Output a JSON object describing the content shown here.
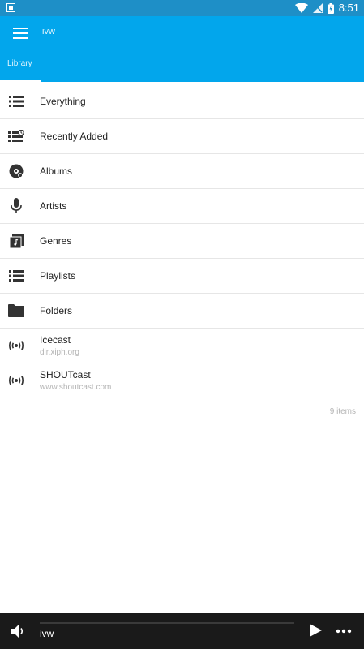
{
  "status_bar": {
    "time": "8:51"
  },
  "app_bar": {
    "title": "ivw"
  },
  "tabs": [
    {
      "label": "Library"
    }
  ],
  "library": {
    "items": [
      {
        "label": "Everything",
        "icon": "list-icon"
      },
      {
        "label": "Recently Added",
        "icon": "recent-list-icon"
      },
      {
        "label": "Albums",
        "icon": "album-disc-icon"
      },
      {
        "label": "Artists",
        "icon": "microphone-icon"
      },
      {
        "label": "Genres",
        "icon": "genre-note-icon"
      },
      {
        "label": "Playlists",
        "icon": "playlist-icon"
      },
      {
        "label": "Folders",
        "icon": "folder-icon"
      },
      {
        "label": "Icecast",
        "subtitle": "dir.xiph.org",
        "icon": "radio-broadcast-icon"
      },
      {
        "label": "SHOUTcast",
        "subtitle": "www.shoutcast.com",
        "icon": "radio-broadcast-icon"
      }
    ],
    "count_text": "9 items"
  },
  "player": {
    "title": "ivw"
  },
  "colors": {
    "status_bar": "#1e8fc7",
    "app_bar": "#02a6ec",
    "player_bg": "#1a1a1a"
  }
}
